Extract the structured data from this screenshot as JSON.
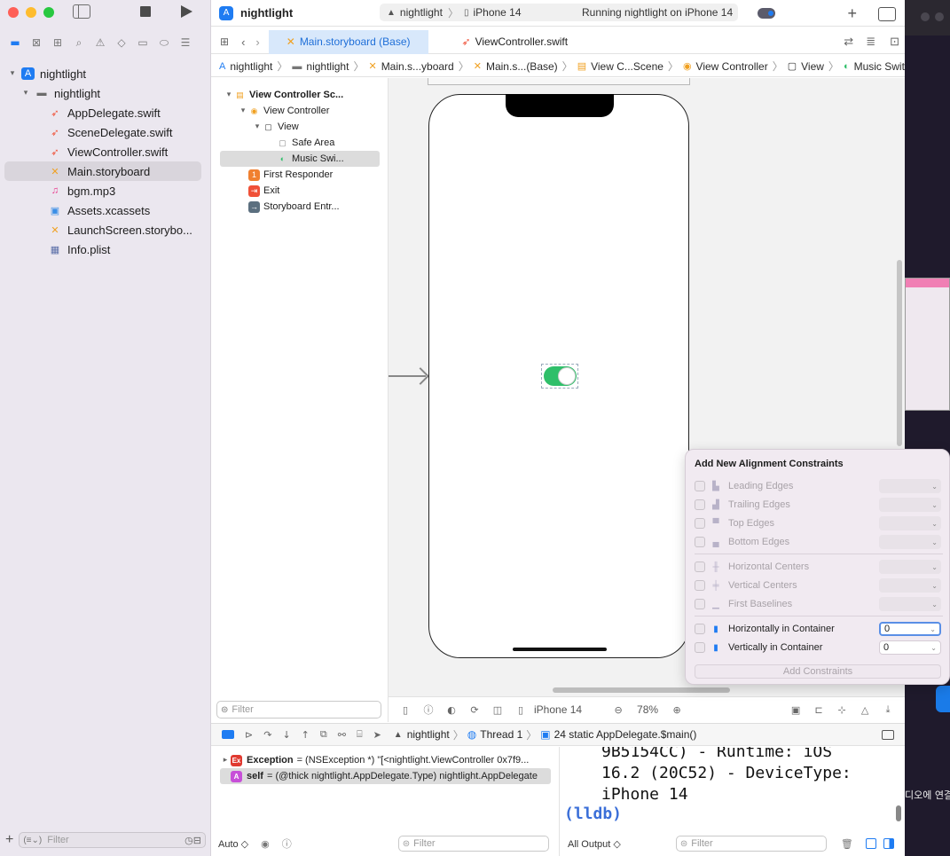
{
  "window": {
    "project_name": "nightlight",
    "scheme": {
      "target": "nightlight",
      "device": "iPhone 14",
      "status": "Running nightlight on iPhone 14"
    }
  },
  "tabs": [
    {
      "label": "Main.storyboard (Base)",
      "active": true
    },
    {
      "label": "ViewController.swift",
      "active": false
    }
  ],
  "jumpbar": [
    "nightlight",
    "nightlight",
    "Main.s...yboard",
    "Main.s...(Base)",
    "View C...Scene",
    "View Controller",
    "View",
    "Music Switch"
  ],
  "navigator": {
    "items": [
      {
        "label": "nightlight",
        "icon": "project-icon",
        "level": 0
      },
      {
        "label": "nightlight",
        "icon": "folder-icon",
        "level": 1
      },
      {
        "label": "AppDelegate.swift",
        "icon": "swift-file-icon",
        "level": 2
      },
      {
        "label": "SceneDelegate.swift",
        "icon": "swift-file-icon",
        "level": 2
      },
      {
        "label": "ViewController.swift",
        "icon": "swift-file-icon",
        "level": 2
      },
      {
        "label": "Main.storyboard",
        "icon": "storyboard-icon",
        "level": 2,
        "selected": true
      },
      {
        "label": "bgm.mp3",
        "icon": "audio-file-icon",
        "level": 2
      },
      {
        "label": "Assets.xcassets",
        "icon": "assets-icon",
        "level": 2
      },
      {
        "label": "LaunchScreen.storybo...",
        "icon": "storyboard-icon",
        "level": 2
      },
      {
        "label": "Info.plist",
        "icon": "plist-icon",
        "level": 2
      }
    ],
    "filter_placeholder": "Filter"
  },
  "outline": {
    "items": [
      {
        "label": "View Controller Sc...",
        "level": 0,
        "bold": true
      },
      {
        "label": "View Controller",
        "level": 1
      },
      {
        "label": "View",
        "level": 2
      },
      {
        "label": "Safe Area",
        "level": 3
      },
      {
        "label": "Music Swi...",
        "level": 3,
        "selected": true
      },
      {
        "label": "First Responder",
        "level": 1
      },
      {
        "label": "Exit",
        "level": 1
      },
      {
        "label": "Storyboard Entr...",
        "level": 1
      }
    ],
    "filter_placeholder": "Filter"
  },
  "canvas_bar": {
    "device": "iPhone 14",
    "zoom": "78%"
  },
  "debug_bar": {
    "target": "nightlight",
    "thread": "Thread 1",
    "frame": "24 static AppDelegate.$main()"
  },
  "variables": [
    {
      "badge": "Ex",
      "name": "Exception",
      "value": "= (NSException *) \"[<nightlight.ViewController 0x7f9..."
    },
    {
      "badge": "A",
      "name": "self",
      "value": "= (@thick nightlight.AppDelegate.Type) nightlight.AppDelegate"
    }
  ],
  "vars_footer": {
    "mode": "Auto ◇",
    "filter_placeholder": "Filter"
  },
  "console": {
    "lines": [
      "9B5154CC) - Runtime: iOS",
      "16.2 (20C52) - DeviceType:",
      "iPhone 14"
    ],
    "prompt": "(lldb)",
    "footer_mode": "All Output ◇",
    "filter_placeholder": "Filter"
  },
  "popover": {
    "title": "Add New Alignment Constraints",
    "rows": [
      {
        "label": "Leading Edges",
        "enabled": false,
        "value": ""
      },
      {
        "label": "Trailing Edges",
        "enabled": false,
        "value": ""
      },
      {
        "label": "Top Edges",
        "enabled": false,
        "value": ""
      },
      {
        "label": "Bottom Edges",
        "enabled": false,
        "value": ""
      },
      {
        "label": "Horizontal Centers",
        "enabled": false,
        "value": ""
      },
      {
        "label": "Vertical Centers",
        "enabled": false,
        "value": ""
      },
      {
        "label": "First Baselines",
        "enabled": false,
        "value": ""
      },
      {
        "label": "Horizontally in Container",
        "enabled": true,
        "value": "0"
      },
      {
        "label": "Vertically in Container",
        "enabled": true,
        "value": "0"
      }
    ],
    "button": "Add Constraints"
  },
  "desktop": {
    "korean_label": "디오에 연결"
  },
  "colors": {
    "accent": "#1f7cf2",
    "switch_on": "#2fbf6a",
    "swift_orange": "#f05138"
  }
}
